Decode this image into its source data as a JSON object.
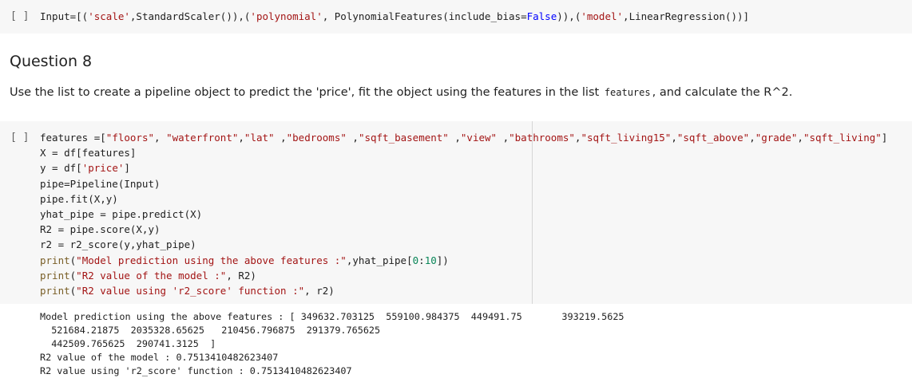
{
  "cell1": {
    "prompt": "[ ]",
    "code_parts": {
      "p1": "Input=[(",
      "s1": "'scale'",
      "p2": ",StandardScaler()),(",
      "s2": "'polynomial'",
      "p3": ", PolynomialFeatures(include_bias=",
      "kw": "False",
      "p4": ")),(",
      "s3": "'model'",
      "p5": ",LinearRegression())]"
    }
  },
  "markdown": {
    "heading": "Question 8",
    "paragraph_before": "Use the list to create a pipeline object to predict the 'price', fit the object using the features in the list ",
    "inline_code": "features",
    "paragraph_after": ", and calculate the R^2."
  },
  "cell2": {
    "prompt": "[ ]",
    "line1": {
      "prefix": "features =[",
      "items": [
        "\"floors\"",
        ", ",
        "\"waterfront\"",
        ",",
        "\"lat\"",
        " ,",
        "\"bedrooms\"",
        " ,",
        "\"sqft_basement\"",
        " ,",
        "\"view\"",
        " ,",
        "\"bathrooms\"",
        ",",
        "\"sqft_living15\"",
        ",",
        "\"sqft_above\"",
        ",",
        "\"grade\"",
        ",",
        "\"sqft_living\""
      ],
      "suffix": "]"
    },
    "line2": "X = df[features]",
    "line3": {
      "a": "y = df[",
      "s": "'price'",
      "b": "]"
    },
    "line4": "pipe=Pipeline(Input)",
    "line5": "pipe.fit(X,y)",
    "line6": "yhat_pipe = pipe.predict(X)",
    "line7": "R2 = pipe.score(X,y)",
    "line8": "r2 = r2_score(y,yhat_pipe)",
    "line9": {
      "fn": "print",
      "a": "(",
      "s": "\"Model prediction using the above features :\"",
      "b": ",yhat_pipe[",
      "n1": "0",
      "c": ":",
      "n2": "10",
      "d": "])"
    },
    "line10": {
      "fn": "print",
      "a": "(",
      "s": "\"R2 value of the model :\"",
      "b": ", R2)"
    },
    "line11": {
      "fn": "print",
      "a": "(",
      "s": "\"R2 value using 'r2_score' function :\"",
      "b": ", r2)"
    }
  },
  "output": {
    "lines": [
      "Model prediction using the above features : [ 349632.703125  559100.984375  449491.75       393219.5625",
      "  521684.21875  2035328.65625   210456.796875  291379.765625",
      "  442509.765625  290741.3125  ]",
      "R2 value of the model : 0.7513410482623407",
      "R2 value using 'r2_score' function : 0.7513410482623407"
    ]
  }
}
